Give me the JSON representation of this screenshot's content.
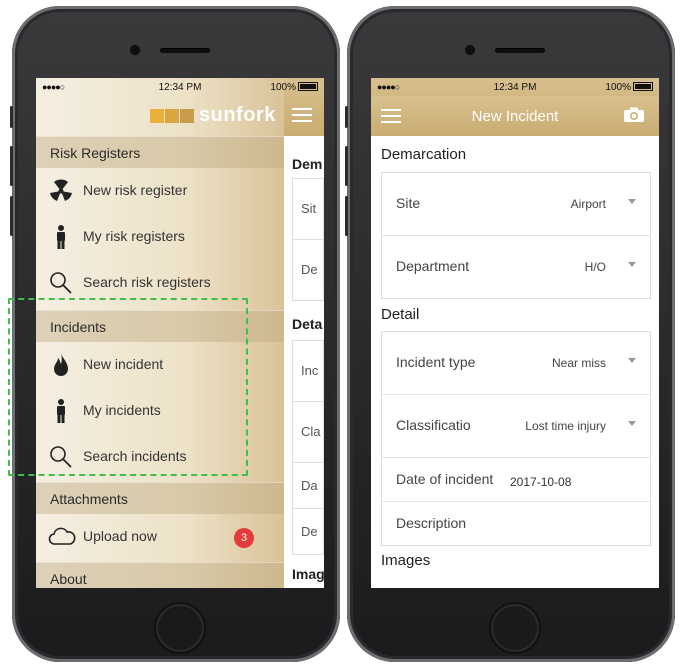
{
  "status": {
    "carrier": "●●●●○",
    "time": "12:34 PM",
    "battery": "100%"
  },
  "left_phone": {
    "logo_text": "sunfork",
    "logo_colors": [
      "#e8b23a",
      "#dba640",
      "#c99b4d"
    ],
    "sections": [
      {
        "header": "Risk Registers",
        "items": [
          {
            "icon": "radiation-icon",
            "label": "New risk register"
          },
          {
            "icon": "person-icon",
            "label": "My risk registers"
          },
          {
            "icon": "search-icon",
            "label": "Search risk registers"
          }
        ]
      },
      {
        "header": "Incidents",
        "items": [
          {
            "icon": "flame-icon",
            "label": "New incident"
          },
          {
            "icon": "person-icon",
            "label": "My incidents"
          },
          {
            "icon": "search-icon",
            "label": "Search incidents"
          }
        ]
      },
      {
        "header": "Attachments",
        "items": [
          {
            "icon": "cloud-icon",
            "label": "Upload now",
            "badge": "3"
          }
        ]
      },
      {
        "header": "About",
        "items": []
      }
    ],
    "peek": {
      "dem": "Dem",
      "deta": "Deta",
      "imag": "Imag",
      "cells": [
        "Sit",
        "De",
        "Inc",
        "Cla",
        "Da",
        "De"
      ]
    }
  },
  "right_phone": {
    "title": "New Incident",
    "sections": {
      "demarcation": "Demarcation",
      "detail": "Detail",
      "images": "Images"
    },
    "fields": {
      "site": {
        "label": "Site",
        "value": "Airport"
      },
      "department": {
        "label": "Department",
        "value": "H/O"
      },
      "incident_type": {
        "label": "Incident type",
        "value": "Near miss"
      },
      "classification": {
        "label": "Classificatio",
        "value": "Lost time injury"
      },
      "date": {
        "label": "Date of incident",
        "value": "2017-10-08"
      },
      "description": {
        "label": "Description"
      }
    }
  },
  "colors": {
    "accent": "#c9ac72",
    "badge": "#e23b3b",
    "highlight": "#3dbf4a"
  }
}
